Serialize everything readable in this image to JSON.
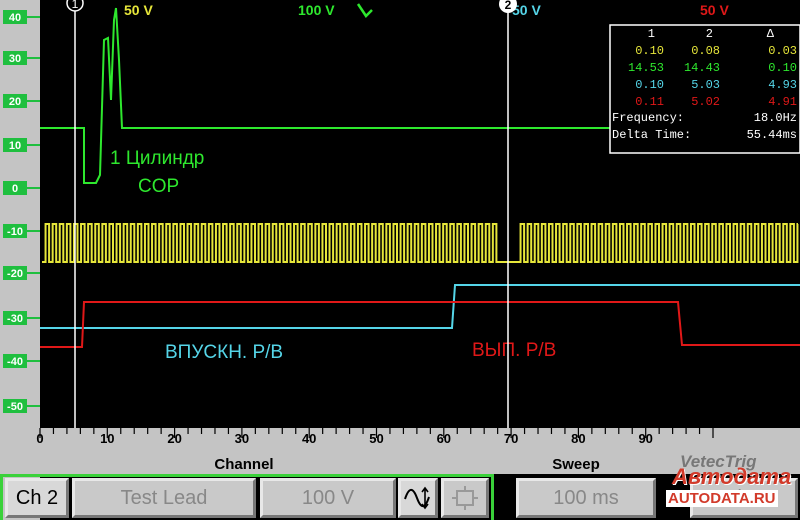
{
  "scope": {
    "y_labels": [
      "40",
      "30",
      "20",
      "10",
      "0",
      "-10",
      "-20",
      "-30",
      "-40",
      "-50"
    ],
    "x_ticks": [
      "0",
      "10",
      "20",
      "30",
      "40",
      "50",
      "60",
      "70",
      "80",
      "90"
    ],
    "x_axis_titles": {
      "channel": "Channel",
      "sweep": "Sweep"
    },
    "top_scale_labels": {
      "ch1": "50 V",
      "ch2": "100 V",
      "ch3": "50 V",
      "ch4": "50 V"
    },
    "cursor_labels": {
      "c1": "1",
      "c2": "2"
    },
    "annotations": {
      "cylinder": "1 Цилиндр",
      "sensor": "COP",
      "intake": "ВПУСКН. Р/В",
      "exhaust": "ВЫП. Р/В"
    },
    "colors": {
      "ch1": "#2ee82e",
      "ch2": "#e6e63a",
      "ch3": "#55d5e8",
      "ch4": "#e01818",
      "background": "#000000",
      "grid_panel": "#c4c4c4"
    }
  },
  "measurements": {
    "headers": [
      "1",
      "2",
      "Δ"
    ],
    "rows": [
      {
        "color": "#e6e63a",
        "v1": "0.10",
        "v2": "0.08",
        "delta": "0.03"
      },
      {
        "color": "#2ee82e",
        "v1": "14.53",
        "v2": "14.43",
        "delta": "0.10"
      },
      {
        "color": "#55d5e8",
        "v1": "0.10",
        "v2": "5.03",
        "delta": "4.93"
      },
      {
        "color": "#e01818",
        "v1": "0.11",
        "v2": "5.02",
        "delta": "4.91"
      }
    ],
    "frequency_label": "Frequency:",
    "frequency_value": "18.0Hz",
    "delta_time_label": "Delta Time:",
    "delta_time_value": "55.44ms"
  },
  "toolbar": {
    "channel": "Ch 2",
    "probe": "Test Lead",
    "scale": "100 V",
    "sweep": "100 ms",
    "trigger_channel": "Ch 2"
  },
  "logo": {
    "line1": "VetecTrig",
    "line2": "Автодата",
    "line3": "AUTODATA.RU"
  }
}
